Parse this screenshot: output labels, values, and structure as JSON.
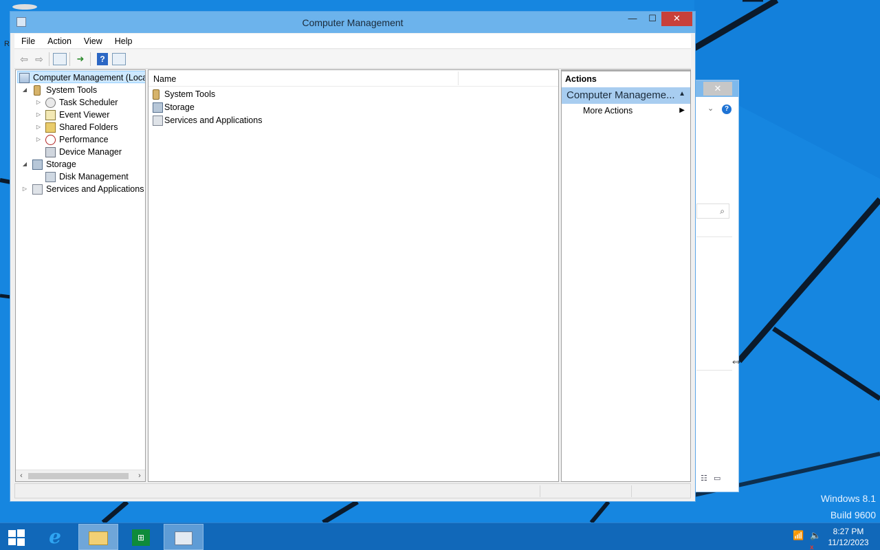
{
  "desktop": {
    "watermark_line1": "Windows 8.1",
    "watermark_line2": "Build 9600",
    "icon_label_fragment": "R"
  },
  "window": {
    "title": "Computer Management",
    "minimize": "—",
    "maximize": "☐",
    "close": "✕"
  },
  "menu": [
    "File",
    "Action",
    "View",
    "Help"
  ],
  "toolbar": {
    "back": "⇦",
    "forward": "⇨",
    "help": "?"
  },
  "tree": {
    "root": "Computer Management (Local",
    "system_tools": "System Tools",
    "task_scheduler": "Task Scheduler",
    "event_viewer": "Event Viewer",
    "shared_folders": "Shared Folders",
    "performance": "Performance",
    "device_manager": "Device Manager",
    "storage": "Storage",
    "disk_management": "Disk Management",
    "services_apps": "Services and Applications"
  },
  "list": {
    "column_name": "Name",
    "items": [
      "System Tools",
      "Storage",
      "Services and Applications"
    ]
  },
  "actions": {
    "header": "Actions",
    "group": "Computer Manageme...",
    "item": "More Actions"
  },
  "taskbar": {
    "time": "8:27 PM",
    "date": "11/12/2023"
  },
  "colors": {
    "desktop": "#1686e0",
    "titlebar": "#6cb3ec",
    "close_button": "#c8403a",
    "selection": "#cde8ff",
    "actions_group": "#a8cdf0",
    "taskbar": "#1168b9"
  }
}
